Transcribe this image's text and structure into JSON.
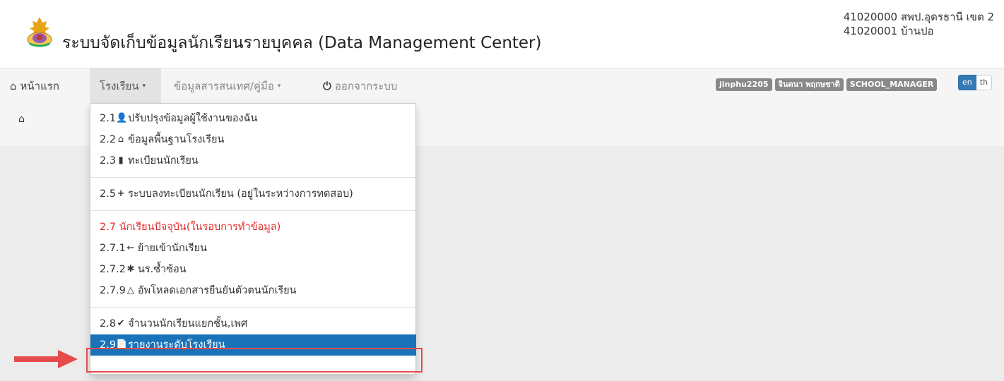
{
  "header": {
    "title": "ระบบจัดเก็บข้อมูลนักเรียนรายบุคคล (Data Management Center)",
    "school_line1": "41020000 สพป.อุดรธานี เขต 2",
    "school_line2": "41020001 บ้านปอ",
    "logo_icon": "school-emblem-icon"
  },
  "nav": {
    "home": "หน้าแรก",
    "school": "โรงเรียน",
    "info": "ข้อมูลสารสนเทศ/คู่มือ",
    "logout": "ออกจากระบบ",
    "user_badges": [
      "jinphu2205",
      "จินดนา พฤกษชาติ",
      "SCHOOL_MANAGER"
    ],
    "lang_en": "en",
    "lang_th": "th"
  },
  "menu": {
    "m21": "2.1 ",
    "m21_text": "ปรับปรุงข้อมูลผู้ใช้งานของฉัน",
    "m22": "2.2 ",
    "m22_text": "ข้อมูลพื้นฐานโรงเรียน",
    "m23": "2.3 ",
    "m23_text": "ทะเบียนนักเรียน",
    "m25": "2.5 ",
    "m25_text": "ระบบลงทะเบียนนักเรียน (อยู่ในระหว่างการทดสอบ)",
    "m27": "2.7 นักเรียนปัจจุบัน(ในรอบการทำข้อมูล)",
    "m271": "2.7.1 ",
    "m271_text": "ย้ายเข้านักเรียน",
    "m272": "2.7.2 ",
    "m272_text": "นร.ซ้ำซ้อน",
    "m279": "2.7.9 ",
    "m279_text": " อัพโหลดเอกสารยืนยันตัวตนนักเรียน",
    "m28": "2.8 ",
    "m28_text": " จำนวนนักเรียนแยกชั้น,เพศ",
    "m29": "2.9 ",
    "m29_text": " รายงานระดับโรงเรียน"
  },
  "colors": {
    "highlight": "#1a73b9",
    "red_text": "#e02a2a",
    "annotation": "#e54b4b"
  }
}
